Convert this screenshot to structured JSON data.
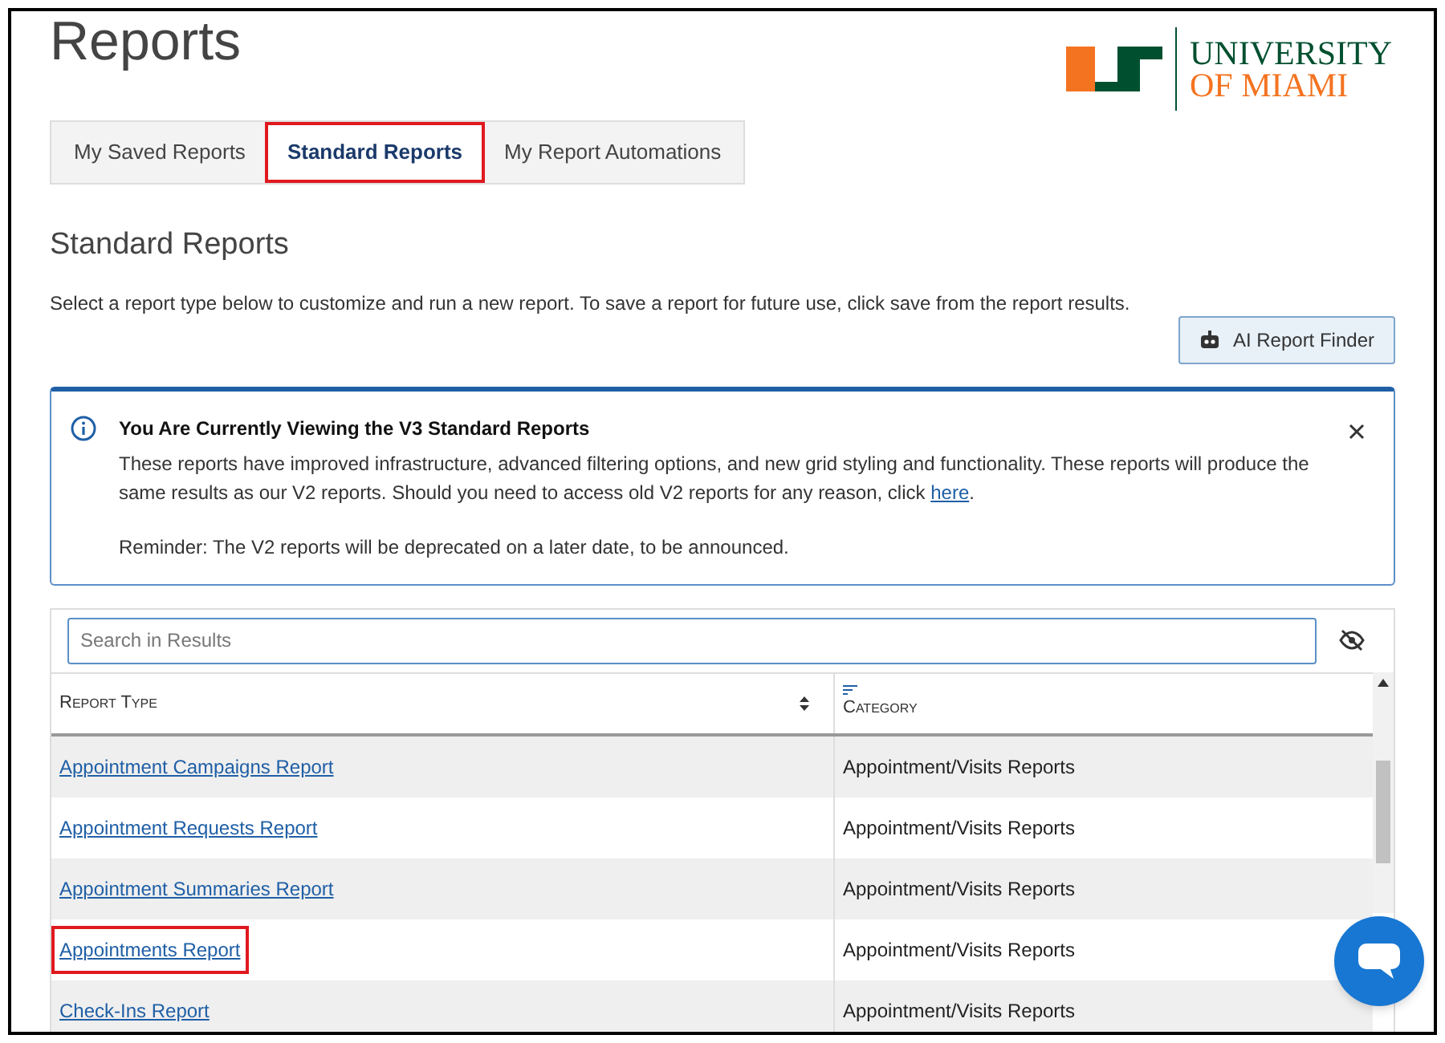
{
  "page_title": "Reports",
  "logo": {
    "line_1": "UNIVERSITY",
    "line_2": "OF MIAMI"
  },
  "tabs": [
    {
      "label": "My Saved Reports",
      "selected": false,
      "highlighted": false
    },
    {
      "label": "Standard Reports",
      "selected": true,
      "highlighted": true
    },
    {
      "label": "My Report Automations",
      "selected": false,
      "highlighted": false
    }
  ],
  "section_title": "Standard Reports",
  "description": "Select a report type below to customize and run a new report. To save a report for future use, click save from the report results.",
  "finder_button": "AI Report Finder",
  "alert": {
    "title": "You Are Currently Viewing the V3 Standard Reports",
    "body": "These reports have improved infrastructure, advanced filtering options, and new grid styling and functionality. These reports will produce the same results as our V2 reports. Should you need to access old V2 reports for any reason, click",
    "link": "here",
    "after_link": ".",
    "reminder": "Reminder: The V2 reports will be deprecated on a later date, to be announced."
  },
  "search": {
    "placeholder": "Search in Results"
  },
  "table": {
    "columns": [
      "Report Type",
      "Category"
    ],
    "rows": [
      {
        "report_type": "Appointment Campaigns Report",
        "category": "Appointment/Visits Reports",
        "highlighted": false
      },
      {
        "report_type": "Appointment Requests Report",
        "category": "Appointment/Visits Reports",
        "highlighted": false
      },
      {
        "report_type": "Appointment Summaries Report",
        "category": "Appointment/Visits Reports",
        "highlighted": false
      },
      {
        "report_type": "Appointments Report",
        "category": "Appointment/Visits Reports",
        "highlighted": true
      },
      {
        "report_type": "Check-Ins Report",
        "category": "Appointment/Visits Reports",
        "highlighted": false
      }
    ]
  }
}
